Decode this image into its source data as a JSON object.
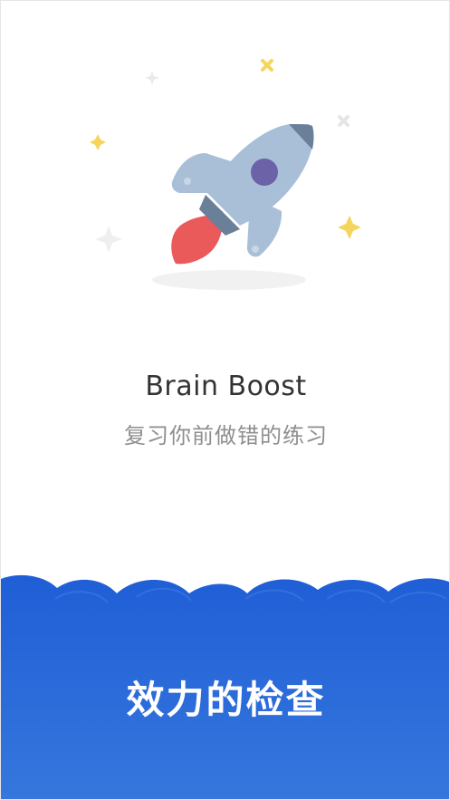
{
  "splash": {
    "app_name": "Brain Boost",
    "tagline": "复习你前做错的练习",
    "cta_label": "效力的检查"
  },
  "icons": {
    "hero": "rocket-icon",
    "decor": "sparkle-icon"
  },
  "colors": {
    "background": "#ffffff",
    "rocket_body": "#a9bfd8",
    "rocket_dark": "#6a7f98",
    "rocket_window": "#6b62a8",
    "flame": "#ea5a5a",
    "star_yellow": "#f6d55c",
    "star_grey": "#e4e4e4",
    "cloud_top": "#1f5ed6",
    "cloud_bottom": "#3677dd"
  }
}
